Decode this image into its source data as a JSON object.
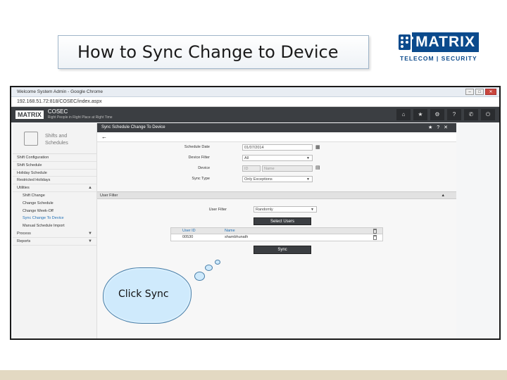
{
  "slide": {
    "title": "How to Sync Change to Device",
    "logo_name": "MATRIX",
    "logo_tagline": "TELECOM | SECURITY",
    "callout": "Click Sync"
  },
  "browser": {
    "tab_title": "Welcome System Admin - Google Chrome",
    "url": "192.168.51.72:818/COSEC/index.aspx"
  },
  "app": {
    "brand": "MATRIX",
    "product": "COSEC",
    "product_tagline": "Right People in Right Place at Right Time",
    "header_icons": [
      "home-icon",
      "star-icon",
      "gear-icon",
      "help-icon",
      "phone-icon",
      "power-icon"
    ]
  },
  "sidebar": {
    "module_title": "Shifts and",
    "module_subtitle": "Schedules",
    "items": [
      {
        "label": "Shift Configuration",
        "sub": false
      },
      {
        "label": "Shift Schedule",
        "sub": false
      },
      {
        "label": "Holiday Schedule",
        "sub": false
      },
      {
        "label": "Restricted Holidays",
        "sub": false
      },
      {
        "label": "Utilities",
        "sub": false,
        "caret": "▲"
      },
      {
        "label": "Shift Change",
        "sub": true
      },
      {
        "label": "Change Schedule",
        "sub": true
      },
      {
        "label": "Change Week-Off",
        "sub": true
      },
      {
        "label": "Sync Change To Device",
        "sub": true,
        "active": true
      },
      {
        "label": "Manual Schedule Import",
        "sub": true
      },
      {
        "label": "Process",
        "sub": false,
        "caret": "▼"
      },
      {
        "label": "Reports",
        "sub": false,
        "caret": "▼"
      }
    ]
  },
  "panel": {
    "title": "Sync Schedule Change To Device",
    "back": "←",
    "schedule_date_label": "Schedule Date",
    "schedule_date_value": "01/07/2014",
    "device_filter_label": "Device Filter",
    "device_filter_value": "All",
    "device_label": "Device",
    "device_id_placeholder": "ID",
    "device_name_placeholder": "Name",
    "sync_type_label": "Sync Type",
    "sync_type_value": "Only Exceptions",
    "user_filter_section": "User Filter",
    "user_filter_label": "User Filter",
    "user_filter_value": "Randomly",
    "select_users_button": "Select Users",
    "table_headers": [
      "User ID",
      "Name"
    ],
    "table_rows": [
      [
        "00530",
        "shambhunath"
      ]
    ],
    "sync_button": "Sync"
  }
}
